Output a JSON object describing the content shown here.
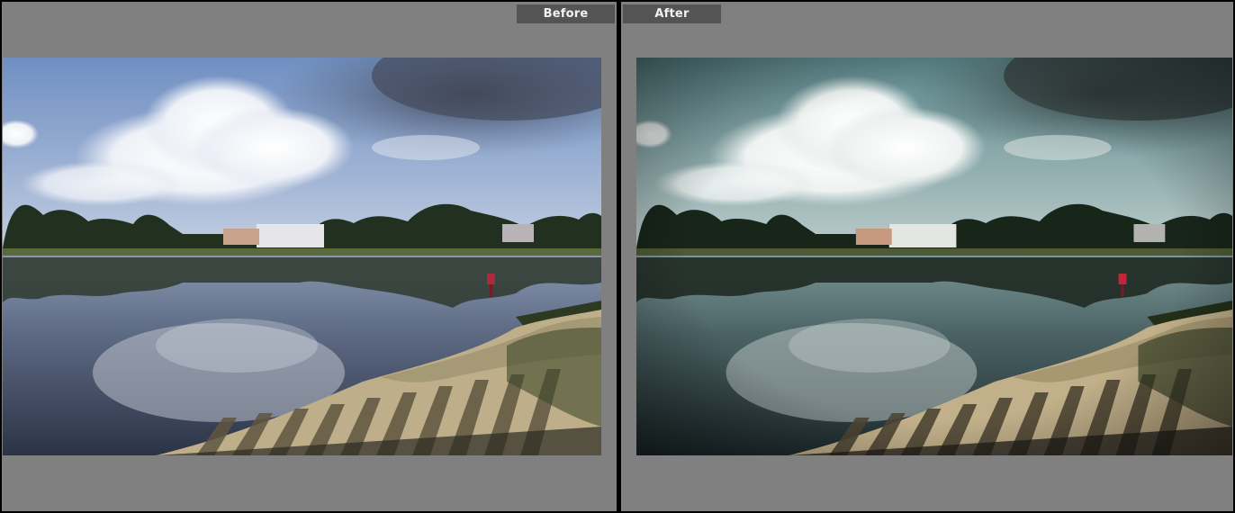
{
  "compare": {
    "before_label": "Before",
    "after_label": "After"
  },
  "colors": {
    "background": "#808080",
    "divider": "#000000",
    "label_bg": "#545454",
    "label_text": "#f2f2f2"
  },
  "photos": {
    "before": "lake-with-clouds-photo-original",
    "after": "lake-with-clouds-photo-edited"
  }
}
